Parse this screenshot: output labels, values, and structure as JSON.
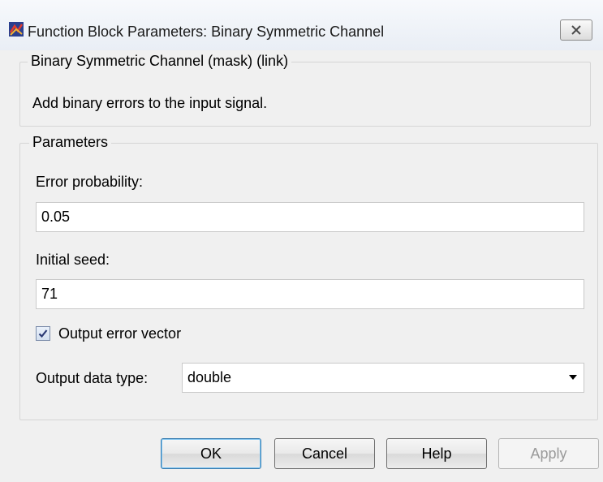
{
  "window": {
    "title": "Function Block Parameters: Binary Symmetric Channel",
    "app_icon": "simulink-icon",
    "close_icon": "close-icon"
  },
  "description_group": {
    "legend": "Binary Symmetric Channel (mask) (link)",
    "text": "Add binary errors to the input signal."
  },
  "parameters": {
    "legend": "Parameters",
    "error_probability": {
      "label": "Error probability:",
      "value": "0.05"
    },
    "initial_seed": {
      "label": "Initial seed:",
      "value": "71"
    },
    "output_error_vector": {
      "label": "Output error vector",
      "checked": true
    },
    "output_data_type": {
      "label": "Output data type:",
      "value": "double"
    }
  },
  "buttons": {
    "ok": "OK",
    "cancel": "Cancel",
    "help": "Help",
    "apply": "Apply"
  }
}
